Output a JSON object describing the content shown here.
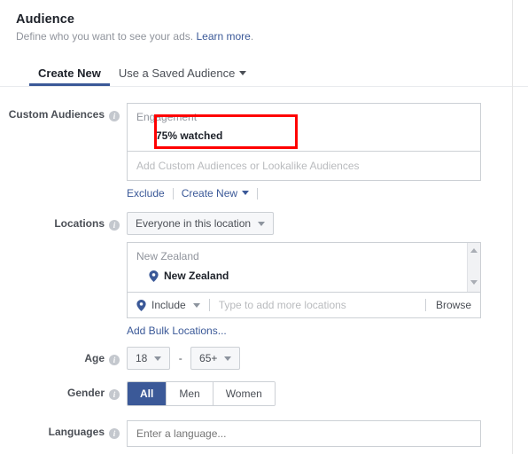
{
  "header": {
    "title": "Audience",
    "subtitle_text": "Define who you want to see your ads.",
    "learn_more": "Learn more",
    "subtitle_period": "."
  },
  "tabs": [
    {
      "label": "Create New",
      "active": true
    },
    {
      "label": "Use a Saved Audience",
      "active": false,
      "has_caret": true
    }
  ],
  "custom_audiences": {
    "label": "Custom Audiences",
    "group_label": "Engagement",
    "selected_item": "75% watched",
    "input_placeholder": "Add Custom Audiences or Lookalike Audiences",
    "exclude_link": "Exclude",
    "create_new_link": "Create New"
  },
  "annotation": {
    "color": "#ff0000",
    "shape": "rectangle",
    "surrounds": "Engagement / 75% watched"
  },
  "locations": {
    "label": "Locations",
    "scope_dropdown": "Everyone in this location",
    "group_label": "New Zealand",
    "selected_location": "New Zealand",
    "include_dropdown": "Include",
    "input_placeholder": "Type to add more locations",
    "browse_label": "Browse",
    "bulk_link": "Add Bulk Locations..."
  },
  "age": {
    "label": "Age",
    "min": "18",
    "max": "65+",
    "separator": "-"
  },
  "gender": {
    "label": "Gender",
    "options": [
      {
        "label": "All",
        "selected": true
      },
      {
        "label": "Men",
        "selected": false
      },
      {
        "label": "Women",
        "selected": false
      }
    ]
  },
  "languages": {
    "label": "Languages",
    "placeholder": "Enter a language...",
    "value": ""
  },
  "colors": {
    "brand_blue": "#3b5998",
    "link_blue": "#3b5998",
    "annotation_red": "#ff0000",
    "border_gray": "#ccd0d5",
    "muted_text": "#90949c"
  },
  "icons": {
    "info": "i",
    "map_pin": "map-pin-icon"
  }
}
